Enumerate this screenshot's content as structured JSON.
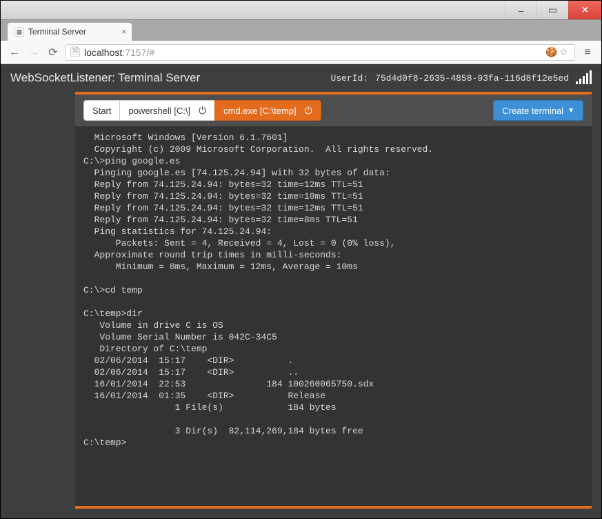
{
  "window": {
    "min": "–",
    "max": "▭",
    "close": "✕"
  },
  "browser": {
    "tab_title": "Terminal Server",
    "url_host": "localhost",
    "url_port": ":7157",
    "url_path": "/#"
  },
  "header": {
    "app_title": "WebSocketListener: Terminal Server",
    "userid_label": "UserId:",
    "userid_value": "75d4d0f8-2635-4858-93fa-116d8f12e5ed"
  },
  "tabs": {
    "start": "Start",
    "powershell": "powershell [C:\\]",
    "cmd": "cmd.exe [C:\\temp]"
  },
  "buttons": {
    "create": "Create terminal"
  },
  "terminal_lines": [
    "  Microsoft Windows [Version 6.1.7601]",
    "  Copyright (c) 2009 Microsoft Corporation.  All rights reserved.",
    "C:\\>ping google.es",
    "  Pinging google.es [74.125.24.94] with 32 bytes of data:",
    "  Reply from 74.125.24.94: bytes=32 time=12ms TTL=51",
    "  Reply from 74.125.24.94: bytes=32 time=10ms TTL=51",
    "  Reply from 74.125.24.94: bytes=32 time=12ms TTL=51",
    "  Reply from 74.125.24.94: bytes=32 time=8ms TTL=51",
    "  Ping statistics for 74.125.24.94:",
    "      Packets: Sent = 4, Received = 4, Lost = 0 (0% loss),",
    "  Approximate round trip times in milli-seconds:",
    "      Minimum = 8ms, Maximum = 12ms, Average = 10ms",
    "",
    "C:\\>cd temp",
    "",
    "C:\\temp>dir",
    "   Volume in drive C is OS",
    "   Volume Serial Number is 042C-34C5",
    "   Directory of C:\\temp",
    "  02/06/2014  15:17    <DIR>          .",
    "  02/06/2014  15:17    <DIR>          ..",
    "  16/01/2014  22:53               184 100260065750.sdx",
    "  16/01/2014  01:35    <DIR>          Release",
    "                 1 File(s)            184 bytes",
    "",
    "                 3 Dir(s)  82,114,269,184 bytes free",
    "C:\\temp>"
  ]
}
